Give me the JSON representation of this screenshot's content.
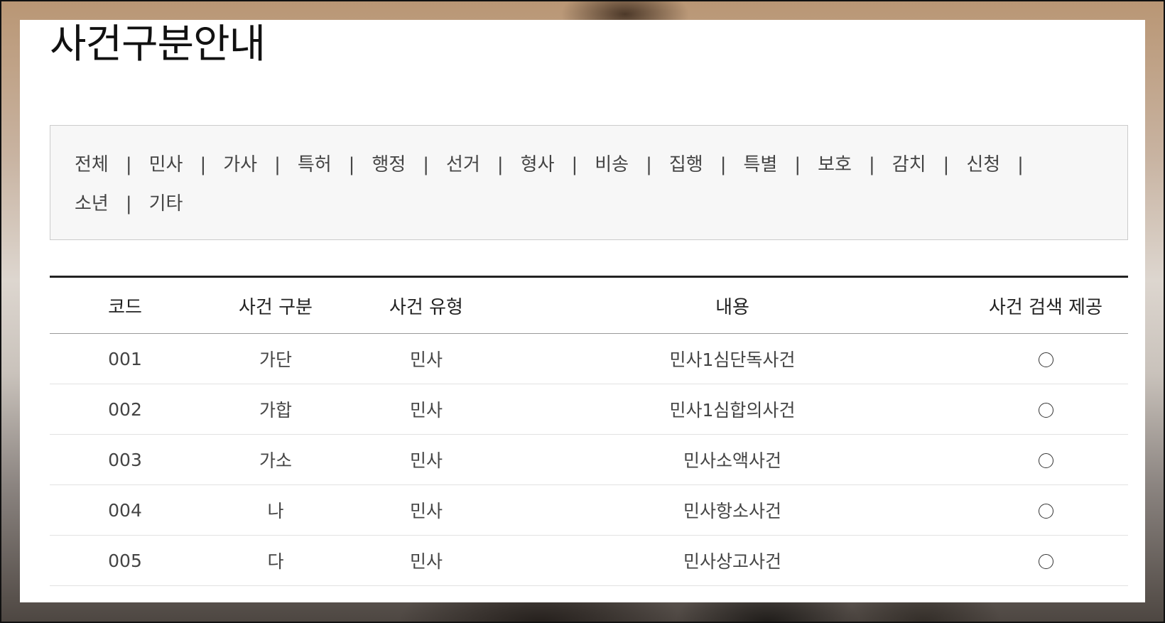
{
  "page": {
    "title": "사건구분안내"
  },
  "filters": [
    {
      "label": "전체"
    },
    {
      "label": "민사"
    },
    {
      "label": "가사"
    },
    {
      "label": "특허"
    },
    {
      "label": "행정"
    },
    {
      "label": "선거"
    },
    {
      "label": "형사"
    },
    {
      "label": "비송"
    },
    {
      "label": "집행"
    },
    {
      "label": "특별"
    },
    {
      "label": "보호"
    },
    {
      "label": "감치"
    },
    {
      "label": "신청"
    },
    {
      "label": "소년"
    },
    {
      "label": "기타"
    }
  ],
  "filter_separator": "|",
  "table": {
    "headers": {
      "code": "코드",
      "gubun": "사건 구분",
      "type": "사건 유형",
      "desc": "내용",
      "search": "사건 검색 제공"
    },
    "rows": [
      {
        "code": "001",
        "gubun": "가단",
        "type": "민사",
        "desc": "민사1심단독사건",
        "search_icon": "circle-icon"
      },
      {
        "code": "002",
        "gubun": "가합",
        "type": "민사",
        "desc": "민사1심합의사건",
        "search_icon": "circle-icon"
      },
      {
        "code": "003",
        "gubun": "가소",
        "type": "민사",
        "desc": "민사소액사건",
        "search_icon": "circle-icon"
      },
      {
        "code": "004",
        "gubun": "나",
        "type": "민사",
        "desc": "민사항소사건",
        "search_icon": "circle-icon"
      },
      {
        "code": "005",
        "gubun": "다",
        "type": "민사",
        "desc": "민사상고사건",
        "search_icon": "circle-icon"
      }
    ]
  }
}
